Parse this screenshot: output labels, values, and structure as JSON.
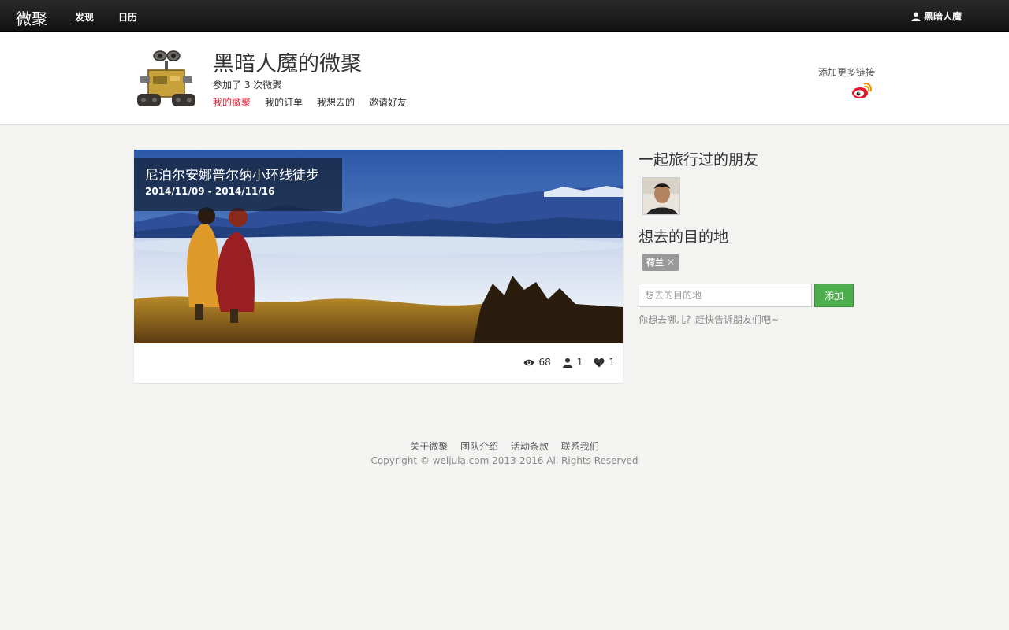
{
  "navbar": {
    "brand": "微聚",
    "links": [
      "发现",
      "日历"
    ],
    "user": "黑暗人魔",
    "user_icon": "user-icon"
  },
  "profile": {
    "title": "黑暗人魔的微聚",
    "subtitle": "参加了 3 次微聚",
    "tabs": [
      "我的微聚",
      "我的订单",
      "我想去的",
      "邀请好友"
    ],
    "active_tab": "我的微聚",
    "more_links": "添加更多链接",
    "weibo_icon": "weibo-icon"
  },
  "card": {
    "title": "尼泊尔安娜普尔纳小环线徒步",
    "date": "2014/11/09 - 2014/11/16",
    "views": "68",
    "participants": "1",
    "likes": "1"
  },
  "sidebar": {
    "friends_heading": "一起旅行过的朋友",
    "destinations_heading": "想去的目的地",
    "tags": [
      "荷兰"
    ],
    "input_placeholder": "想去的目的地",
    "add_button": "添加",
    "hint": "你想去哪儿？赶快告诉朋友们吧~"
  },
  "footer": {
    "links": [
      "关于微聚",
      "团队介绍",
      "活动条款",
      "联系我们"
    ],
    "copyright": "Copyright © weijula.com 2013-2016 All Rights Reserved"
  },
  "colors": {
    "active_tab": "#e8263c",
    "add_button": "#4cae4c",
    "navbar": "#1a1a1a"
  }
}
